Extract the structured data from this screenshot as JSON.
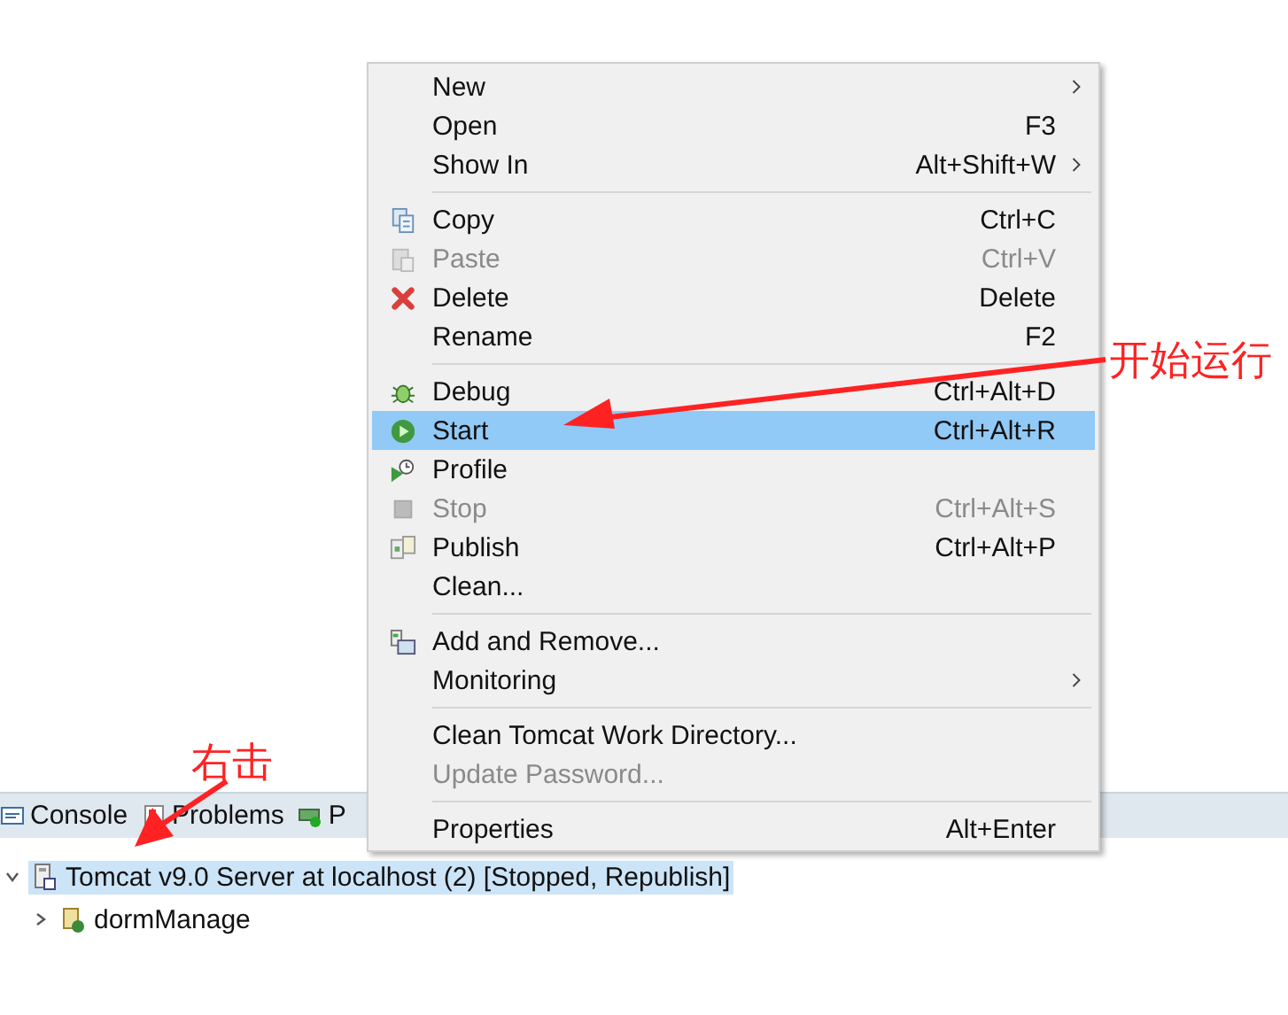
{
  "panel": {
    "tabs": [
      {
        "label": "Console",
        "selected": false
      },
      {
        "label": "Problems",
        "selected": false
      },
      {
        "label": "P",
        "selected": false
      }
    ],
    "tree": [
      {
        "label": "Tomcat v9.0 Server at localhost (2)  [Stopped, Republish]",
        "expanded": true,
        "selected": true,
        "children": [
          {
            "label": "dormManage",
            "expanded": false,
            "selected": false
          }
        ]
      }
    ]
  },
  "context_menu": {
    "items": [
      {
        "kind": "item",
        "label": "New",
        "submenu": true,
        "disabled": false,
        "selected": false
      },
      {
        "kind": "item",
        "label": "Open",
        "shortcut": "F3",
        "disabled": false,
        "selected": false
      },
      {
        "kind": "item",
        "label": "Show In",
        "shortcut": "Alt+Shift+W",
        "submenu": true,
        "disabled": false,
        "selected": false
      },
      {
        "kind": "separator"
      },
      {
        "kind": "item",
        "label": "Copy",
        "shortcut": "Ctrl+C",
        "disabled": false,
        "selected": false
      },
      {
        "kind": "item",
        "label": "Paste",
        "shortcut": "Ctrl+V",
        "disabled": true,
        "selected": false
      },
      {
        "kind": "item",
        "label": "Delete",
        "shortcut": "Delete",
        "disabled": false,
        "selected": false
      },
      {
        "kind": "item",
        "label": "Rename",
        "shortcut": "F2",
        "disabled": false,
        "selected": false
      },
      {
        "kind": "separator"
      },
      {
        "kind": "item",
        "label": "Debug",
        "shortcut": "Ctrl+Alt+D",
        "disabled": false,
        "selected": false
      },
      {
        "kind": "item",
        "label": "Start",
        "shortcut": "Ctrl+Alt+R",
        "disabled": false,
        "selected": true
      },
      {
        "kind": "item",
        "label": "Profile",
        "disabled": false,
        "selected": false
      },
      {
        "kind": "item",
        "label": "Stop",
        "shortcut": "Ctrl+Alt+S",
        "disabled": true,
        "selected": false
      },
      {
        "kind": "item",
        "label": "Publish",
        "shortcut": "Ctrl+Alt+P",
        "disabled": false,
        "selected": false
      },
      {
        "kind": "item",
        "label": "Clean...",
        "disabled": false,
        "selected": false
      },
      {
        "kind": "separator"
      },
      {
        "kind": "item",
        "label": "Add and Remove...",
        "disabled": false,
        "selected": false
      },
      {
        "kind": "item",
        "label": "Monitoring",
        "submenu": true,
        "disabled": false,
        "selected": false
      },
      {
        "kind": "separator"
      },
      {
        "kind": "item",
        "label": "Clean Tomcat Work Directory...",
        "disabled": false,
        "selected": false
      },
      {
        "kind": "item",
        "label": "Update Password...",
        "disabled": true,
        "selected": false
      },
      {
        "kind": "separator"
      },
      {
        "kind": "item",
        "label": "Properties",
        "shortcut": "Alt+Enter",
        "disabled": false,
        "selected": false
      }
    ]
  },
  "annotations": [
    {
      "text": "开始运行"
    },
    {
      "text": "右击"
    }
  ]
}
